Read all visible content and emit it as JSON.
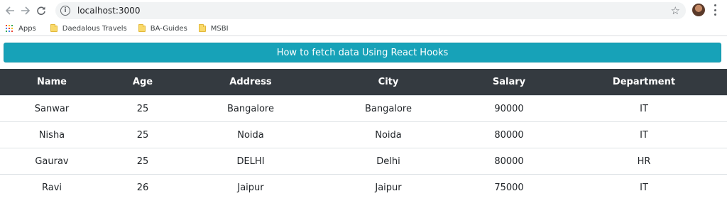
{
  "browser": {
    "url": "localhost:3000",
    "bookmarks": [
      {
        "label": "Apps",
        "icon": "apps-grid-icon"
      },
      {
        "label": "Daedalous Travels",
        "icon": "folder-icon"
      },
      {
        "label": "BA-Guides",
        "icon": "folder-icon"
      },
      {
        "label": "MSBI",
        "icon": "folder-icon"
      }
    ]
  },
  "page": {
    "header_button": "How to fetch data Using React Hooks",
    "accent_color": "#17a2b8",
    "table_header_color": "#343a40"
  },
  "table": {
    "columns": [
      "Name",
      "Age",
      "Address",
      "City",
      "Salary",
      "Department"
    ],
    "rows": [
      [
        "Sanwar",
        "25",
        "Bangalore",
        "Bangalore",
        "90000",
        "IT"
      ],
      [
        "Nisha",
        "25",
        "Noida",
        "Noida",
        "80000",
        "IT"
      ],
      [
        "Gaurav",
        "25",
        "DELHI",
        "Delhi",
        "80000",
        "HR"
      ],
      [
        "Ravi",
        "26",
        "Jaipur",
        "Jaipur",
        "75000",
        "IT"
      ]
    ]
  }
}
